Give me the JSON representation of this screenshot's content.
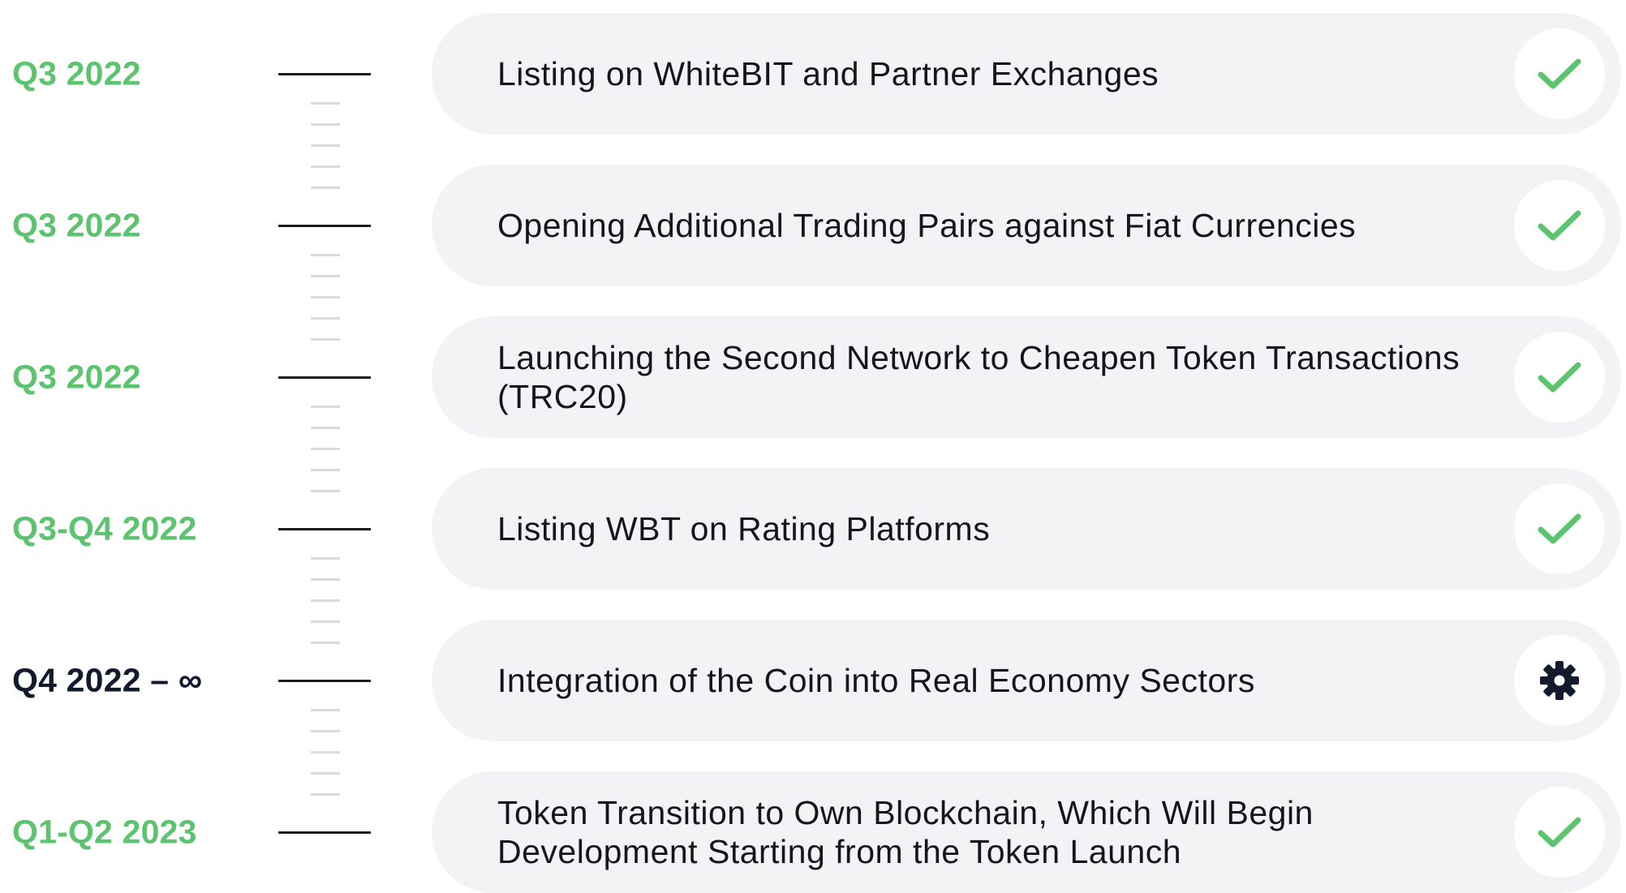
{
  "roadmap": {
    "items": [
      {
        "period": "Q3 2022",
        "text": "Listing on WhiteBIT and Partner Exchanges",
        "status": "completed",
        "status_icon": "check-icon"
      },
      {
        "period": "Q3 2022",
        "text": "Opening Additional Trading Pairs against Fiat Currencies",
        "status": "completed",
        "status_icon": "check-icon"
      },
      {
        "period": "Q3 2022",
        "text": "Launching the Second Network to Cheapen Token Transactions (TRC20)",
        "status": "completed",
        "status_icon": "check-icon"
      },
      {
        "period": "Q3-Q4 2022",
        "text": "Listing WBT on Rating Platforms",
        "status": "completed",
        "status_icon": "check-icon"
      },
      {
        "period": "Q4 2022 – ∞",
        "text": "Integration of the Coin into Real Economy Sectors",
        "status": "in-progress",
        "status_icon": "gear-icon"
      },
      {
        "period": "Q1-Q2 2023",
        "text": "Token Transition to Own Blockchain, Which Will Begin Development Starting from the Token Launch",
        "status": "completed",
        "status_icon": "check-icon"
      }
    ]
  },
  "colors": {
    "completed": "#5cc46f",
    "in_progress": "#141a2e",
    "card_background": "#f3f3f5",
    "text": "#14161c"
  }
}
